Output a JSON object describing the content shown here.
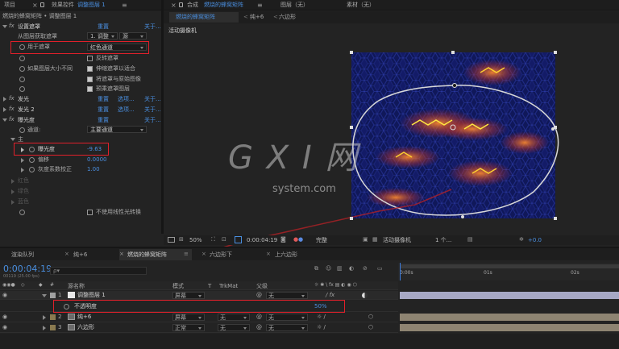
{
  "top_tabs": {
    "project": "项目",
    "effects_controls_prefix": "效果控件",
    "effects_controls_layer": "调整图层 1",
    "menu_icon": "menu-icon",
    "comp_label": "合成",
    "comp_name": "燃烧的蜂窝矩阵",
    "layer_panel": "图层（无）",
    "footage_panel": "素材（无）"
  },
  "ec_header": "燃烧的蜂窝矩阵 • 调整图层 1",
  "comp_tabs": [
    "燃烧的蜂窝矩阵",
    "纯+6",
    "六边形"
  ],
  "effects": [
    {
      "name": "设置遮罩",
      "reset": "重置",
      "about": "关于..."
    },
    {
      "name": "发光",
      "reset": "重置",
      "options": "选项...",
      "about": "关于..."
    },
    {
      "name": "发光 2",
      "reset": "重置",
      "options": "选项...",
      "about": "关于..."
    },
    {
      "name": "曝光度",
      "reset": "重置",
      "about": "关于..."
    }
  ],
  "set_matte": {
    "from_layer_label": "从图层获取遮罩",
    "from_layer_value": "1. 调整",
    "from_layer_src": "源",
    "use_for_label": "用于遮罩",
    "use_for_value": "红色通道",
    "invert": "反转遮罩",
    "if_size_differ": "如果图层大小不同",
    "stretch": "伸缩遮罩以适合",
    "composite": "将遮罩与原始图像",
    "premultiply": "预乘遮罩图层"
  },
  "exposure": {
    "channel_label": "通道:",
    "channel_value": "主要通道",
    "master": "主",
    "exposure_label": "曝光度",
    "exposure_value": "-9.63",
    "offset_label": "偏移",
    "offset_value": "0.0000",
    "gamma_label": "灰度系数校正",
    "gamma_value": "1.00",
    "red": "红色",
    "green": "绿色",
    "blue": "蓝色",
    "linear": "不使用线性光转换"
  },
  "viewer": {
    "camera_label": "活动摄像机",
    "zoom": "50%",
    "timecode": "0:00:04:19",
    "quality": "完整",
    "camera": "活动摄像机",
    "views": "1 个...",
    "exposure": "+0.0"
  },
  "timeline": {
    "tabs": [
      "渲染队列",
      "纯+6",
      "燃烧的蜂窝矩阵",
      "六边形下",
      "上六边形"
    ],
    "timecode": "0:00:04:19",
    "fps": "00119 (25.00 fps)",
    "search_placeholder": "ρ▾",
    "columns": {
      "name": "源名称",
      "mode": "模式",
      "t": "T",
      "trkmat": "TrkMat",
      "parent": "父级"
    },
    "ruler": [
      "0:00s",
      "01s",
      "02s"
    ],
    "layers": [
      {
        "num": "1",
        "name": "调整图层 1",
        "mode": "屏幕",
        "parent": "无",
        "fx": true
      },
      {
        "num": "2",
        "name": "纯+6",
        "mode": "屏幕",
        "parent": "无",
        "fx": false
      },
      {
        "num": "3",
        "name": "六边形",
        "mode": "正常",
        "parent": "无",
        "fx": false
      }
    ],
    "opacity_label": "不透明度",
    "opacity_value": "50%"
  },
  "watermark": {
    "big": "G X I 网",
    "small": "system.com"
  }
}
